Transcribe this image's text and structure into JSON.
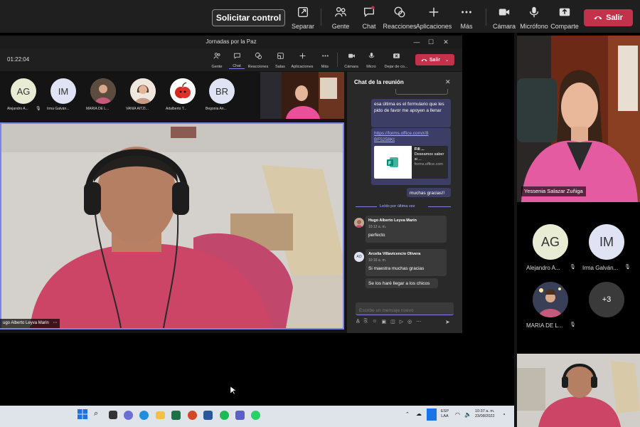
{
  "top_toolbar": {
    "request_control": "Solicitar control",
    "buttons": [
      {
        "label": "Separar",
        "icon": "pop-out-icon"
      },
      {
        "label": "Gente",
        "icon": "people-icon"
      },
      {
        "label": "Chat",
        "icon": "chat-icon"
      },
      {
        "label": "Reacciones",
        "icon": "reactions-icon"
      },
      {
        "label": "Aplicaciones",
        "icon": "plus-icon"
      },
      {
        "label": "Más",
        "icon": "more-icon"
      },
      {
        "label": "Cámara",
        "icon": "camera-icon"
      },
      {
        "label": "Micrófono",
        "icon": "microphone-icon"
      },
      {
        "label": "Comparte",
        "icon": "share-icon"
      }
    ],
    "leave": "Salir"
  },
  "inner_window": {
    "title": "Jornadas por la Paz",
    "timer": "01:22:04",
    "buttons": [
      {
        "label": "Gente"
      },
      {
        "label": "Chat"
      },
      {
        "label": "Reacciones"
      },
      {
        "label": "Salas"
      },
      {
        "label": "Aplicaciones"
      },
      {
        "label": "Más"
      },
      {
        "label": "Cámara"
      },
      {
        "label": "Micro"
      },
      {
        "label": "Dejar de co..."
      }
    ],
    "leave": "Salir"
  },
  "participants_strip": [
    {
      "initials": "AG",
      "name": "Alejandro A..."
    },
    {
      "initials": "IM",
      "name": "Irma Galván..."
    },
    {
      "initials": "",
      "name": "MARIA DE L..."
    },
    {
      "initials": "",
      "name": "VANIA AITZI..."
    },
    {
      "initials": "",
      "name": "Adalberto T..."
    },
    {
      "initials": "BR",
      "name": "Begonia An..."
    }
  ],
  "main_video": {
    "name": "ugo Alberto Leyva Marin"
  },
  "chat": {
    "title": "Chat de la reunión",
    "messages_sent": [
      "esa última es el formulario que les pido de favor me apoyen a llenar",
      "https://forms.office.com/r/8BF5258Kt",
      "muchas gracias!!"
    ],
    "link_card": {
      "title": "Fill ...",
      "desc": "Deseamos saber si ...",
      "domain": "forms.office.com"
    },
    "read_marker": "Leído por última vez",
    "received": [
      {
        "author": "Hugo Alberto Leyva Marín",
        "time": "10:12 a. m.",
        "messages": [
          "perfecto"
        ]
      },
      {
        "author": "Arcelia Villavicencio Olivera",
        "initials": "AO",
        "time": "10:16 a. m.",
        "messages": [
          "Si maestra muchas gracias",
          "Se los haré llegar a los chicos"
        ]
      }
    ],
    "compose_placeholder": "Escribe un mensaje nuevo"
  },
  "right_panel": {
    "spotlight_name": "Yessenia Salazar Zuñiga",
    "participants": [
      {
        "initials": "AG",
        "name": "Alejandro A..."
      },
      {
        "initials": "IM",
        "name": "Irma Galván..."
      },
      {
        "initials": "",
        "name": "MARIA DE L..."
      },
      {
        "initials": "+3",
        "name": ""
      }
    ]
  },
  "taskbar": {
    "language": "ESP",
    "language_sub": "LAA",
    "time": "10:37 a. m.",
    "date": "23/08/2022"
  },
  "colors": {
    "accent": "#7b83eb",
    "leave": "#c4314b",
    "panel": "#292929",
    "bubble": "#3d3e66"
  }
}
